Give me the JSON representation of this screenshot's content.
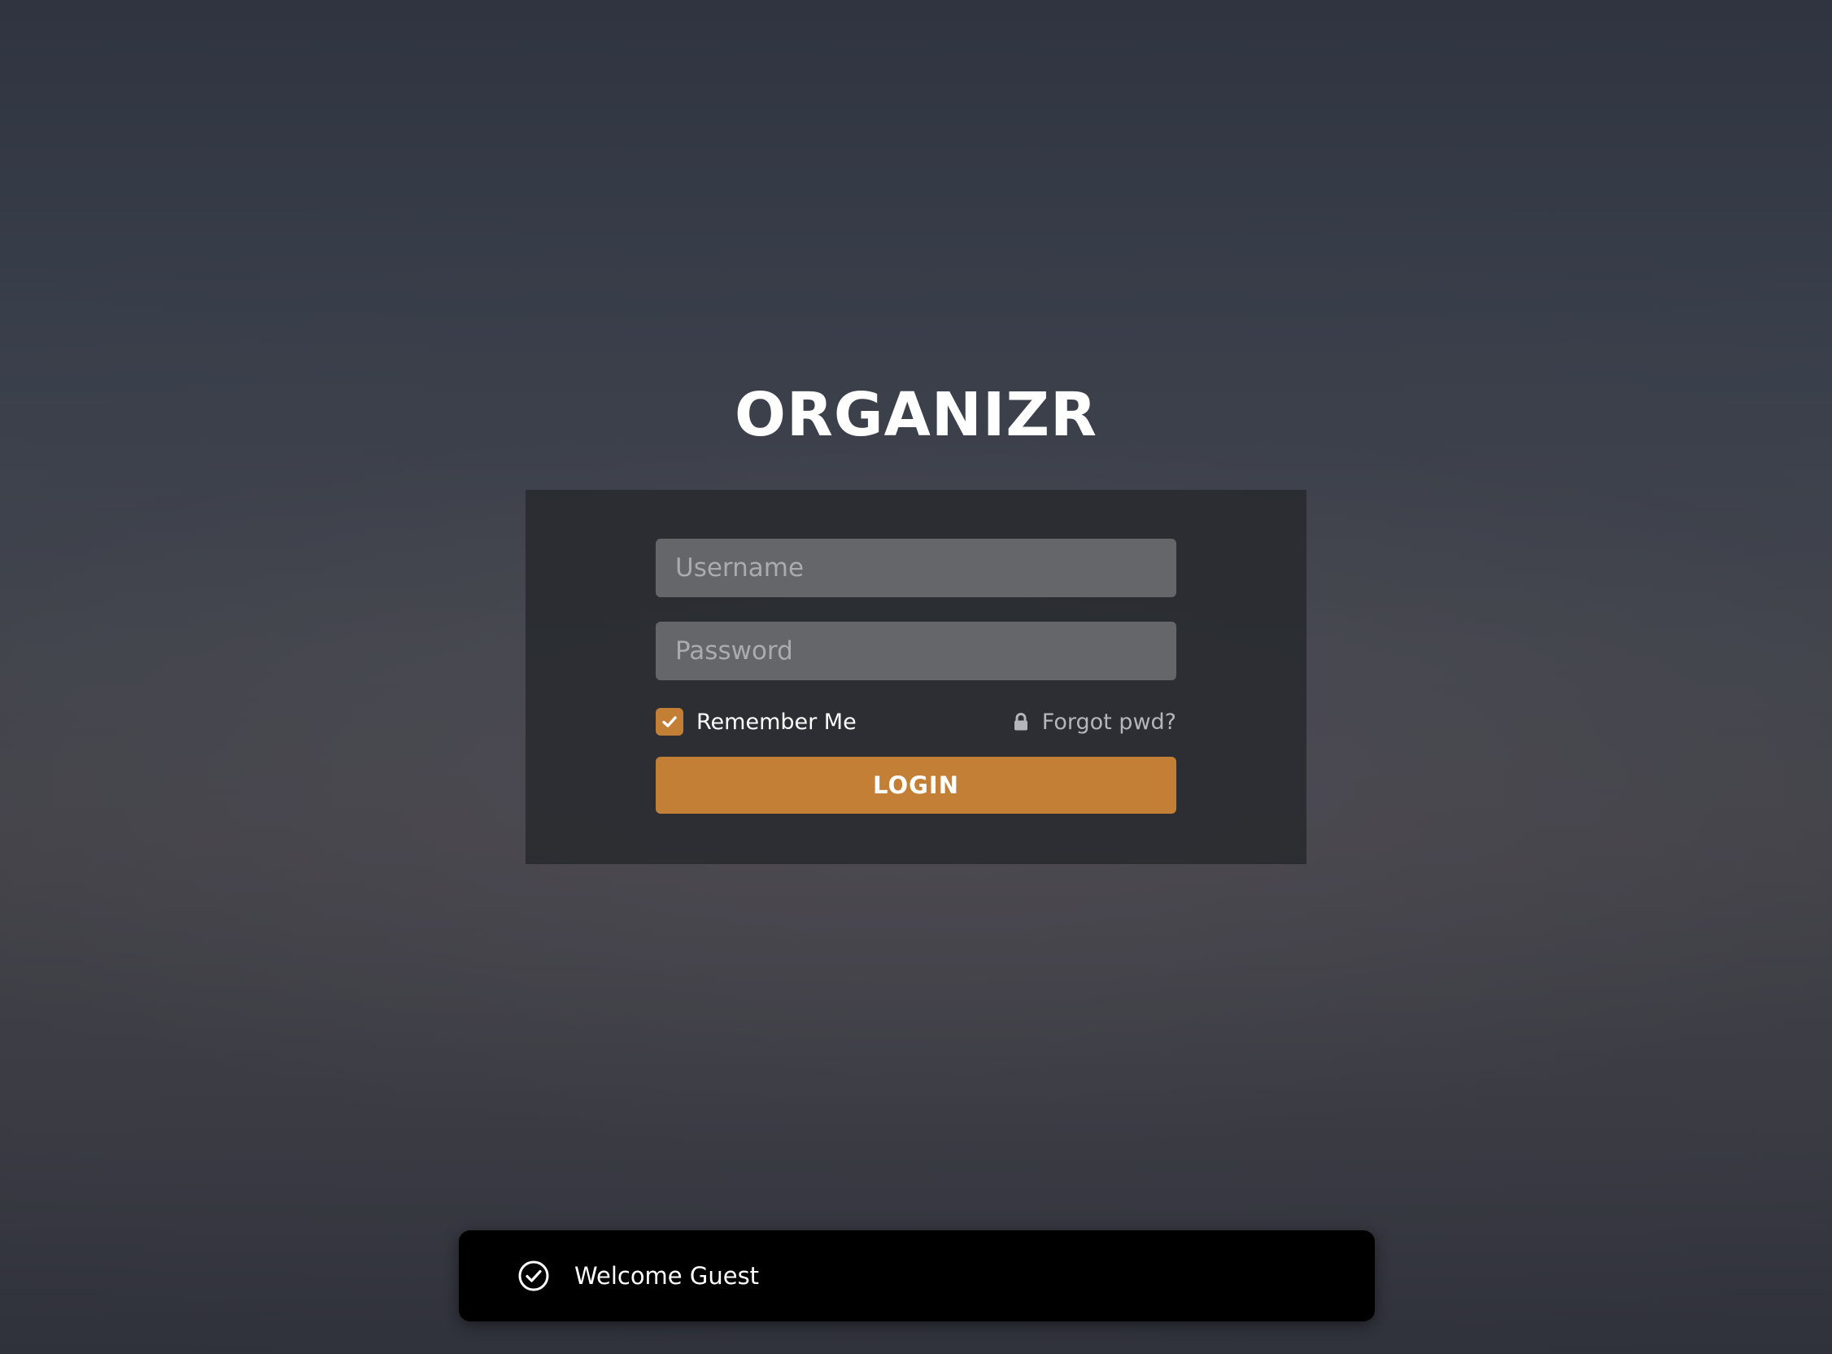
{
  "brand": {
    "title": "ORGANIZR"
  },
  "login_form": {
    "username": {
      "placeholder": "Username",
      "value": ""
    },
    "password": {
      "placeholder": "Password",
      "value": ""
    },
    "remember_me": {
      "label": "Remember Me",
      "checked": true
    },
    "forgot": {
      "label": "Forgot pwd?",
      "icon": "lock-icon"
    },
    "submit_label": "LOGIN"
  },
  "toast": {
    "icon": "check-circle-icon",
    "message": "Welcome Guest"
  },
  "colors": {
    "accent": "#c47f36",
    "panel": "#28292f",
    "input": "#646669",
    "toast": "#000000"
  }
}
